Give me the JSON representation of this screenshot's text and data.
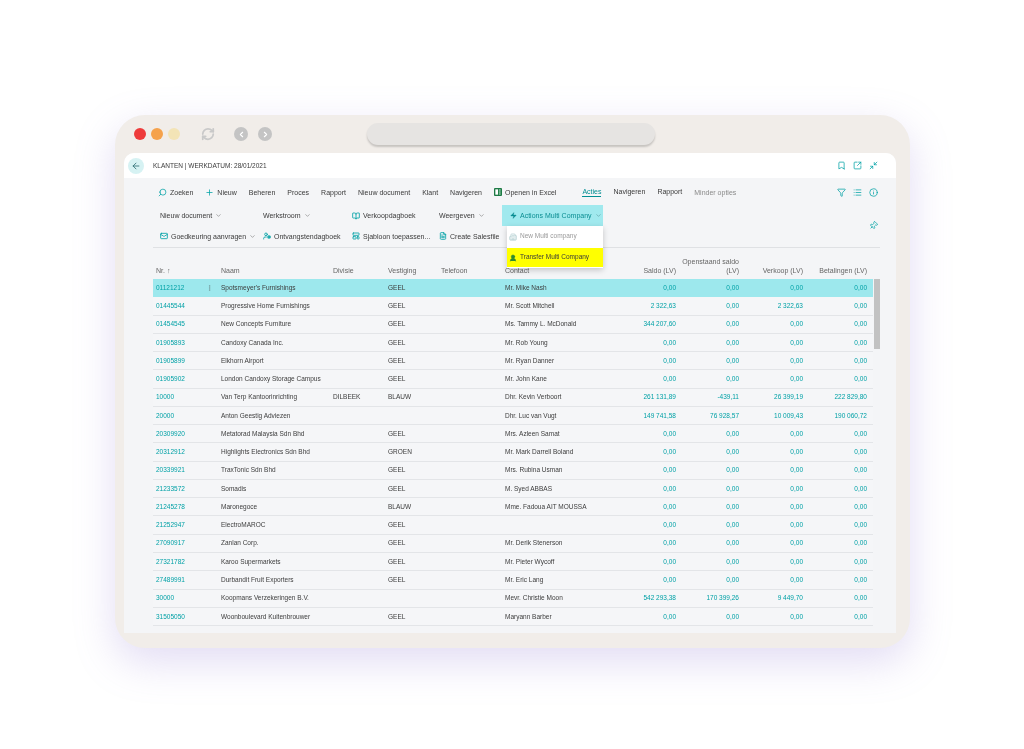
{
  "page": {
    "title": "KLANTEN | WERKDATUM: 28/01/2021"
  },
  "action_bar": {
    "actions": [
      {
        "label": "Zoeken",
        "kind": "search"
      },
      {
        "label": "Nieuw",
        "kind": "new"
      },
      {
        "label": "Beheren",
        "kind": "plain"
      },
      {
        "label": "Proces",
        "kind": "plain"
      },
      {
        "label": "Rapport",
        "kind": "plain"
      },
      {
        "label": "Nieuw document",
        "kind": "plain"
      },
      {
        "label": "Klant",
        "kind": "plain"
      },
      {
        "label": "Navigeren",
        "kind": "plain"
      },
      {
        "label": "Openen in Excel",
        "kind": "excel"
      }
    ],
    "tabs": [
      {
        "label": "Acties",
        "selected": true
      },
      {
        "label": "Navigeren",
        "selected": false
      },
      {
        "label": "Rapport",
        "selected": false
      }
    ],
    "less_options": "Minder opties"
  },
  "action_rows": [
    {
      "items": [
        {
          "label": "Nieuw document",
          "kind": "dropdown"
        },
        {
          "label": "Werkstroom",
          "kind": "dropdown"
        },
        {
          "label": "Verkoopdagboek",
          "kind": "journal"
        },
        {
          "label": "Weergeven",
          "kind": "dropdown"
        }
      ]
    },
    {
      "items": [
        {
          "label": "Goedkeuring aanvragen",
          "kind": "approval"
        },
        {
          "label": "Ontvangstendagboek",
          "kind": "receipts"
        },
        {
          "label": "Sjabloon toepassen...",
          "kind": "template"
        },
        {
          "label": "Create Salesfile",
          "kind": "file"
        }
      ]
    }
  ],
  "multi_company": {
    "label": "Actions Multi Company",
    "expanded": true,
    "menu": [
      {
        "label": "New Multi company",
        "disabled": true,
        "selected": false
      },
      {
        "label": "Transfer Multi Company",
        "disabled": false,
        "selected": true
      }
    ]
  },
  "table": {
    "columns": [
      {
        "label": "Nr. ↑",
        "kind": "link"
      },
      {
        "label": "Naam",
        "kind": "text"
      },
      {
        "label": "Divisie",
        "kind": "text"
      },
      {
        "label": "Vestiging",
        "kind": "text"
      },
      {
        "label": "Telefoon",
        "kind": "text"
      },
      {
        "label": "Contact",
        "kind": "text"
      },
      {
        "label": "Saldo (LV)",
        "kind": "amount"
      },
      {
        "label": "Openstaand saldo (LV)",
        "kind": "amount"
      },
      {
        "label": "Verkoop (LV)",
        "kind": "amount"
      },
      {
        "label": "Betalingen (LV)",
        "kind": "amount"
      }
    ],
    "rows": [
      {
        "selected": true,
        "nr": "01121212",
        "naam": "Spotsmeyer's Furnishings",
        "vestiging": "GEEL",
        "contact": "Mr. Mike Nash",
        "saldo": "0,00",
        "openstaand_saldo": "0,00",
        "verkoop": "0,00",
        "betalingen": "0,00"
      },
      {
        "selected": false,
        "nr": "01445544",
        "naam": "Progressive Home Furnishings",
        "vestiging": "GEEL",
        "contact": "Mr. Scott Mitchell",
        "saldo": "2 322,63",
        "openstaand_saldo": "0,00",
        "verkoop": "2 322,63",
        "betalingen": "0,00"
      },
      {
        "selected": false,
        "nr": "01454545",
        "naam": "New Concepts Furniture",
        "vestiging": "GEEL",
        "contact": "Ms. Tammy L. McDonald",
        "saldo": "344 207,60",
        "openstaand_saldo": "0,00",
        "verkoop": "0,00",
        "betalingen": "0,00"
      },
      {
        "selected": false,
        "nr": "01905893",
        "naam": "Candoxy Canada Inc.",
        "vestiging": "GEEL",
        "contact": "Mr. Rob Young",
        "saldo": "0,00",
        "openstaand_saldo": "0,00",
        "verkoop": "0,00",
        "betalingen": "0,00"
      },
      {
        "selected": false,
        "nr": "01905899",
        "naam": "Elkhorn Airport",
        "vestiging": "GEEL",
        "contact": "Mr. Ryan Danner",
        "saldo": "0,00",
        "openstaand_saldo": "0,00",
        "verkoop": "0,00",
        "betalingen": "0,00"
      },
      {
        "selected": false,
        "nr": "01905902",
        "naam": "London Candoxy Storage Campus",
        "vestiging": "GEEL",
        "contact": "Mr. John Kane",
        "saldo": "0,00",
        "openstaand_saldo": "0,00",
        "verkoop": "0,00",
        "betalingen": "0,00"
      },
      {
        "selected": false,
        "nr": "10000",
        "naam": "Van Terp Kantoorinrichting",
        "divisie": "DILBEEK",
        "vestiging": "BLAUW",
        "contact": "Dhr. Kevin Verboort",
        "saldo": "261 131,89",
        "openstaand_saldo": "-439,11",
        "verkoop": "26 399,19",
        "betalingen": "222 829,80"
      },
      {
        "selected": false,
        "nr": "20000",
        "naam": "Anton Geestig Adviezen",
        "contact": "Dhr. Luc van Vugt",
        "saldo": "149 741,58",
        "openstaand_saldo": "76 928,57",
        "verkoop": "10 009,43",
        "betalingen": "190 060,72"
      },
      {
        "selected": false,
        "nr": "20309920",
        "naam": "Metatorad Malaysia Sdn Bhd",
        "vestiging": "GEEL",
        "contact": "Mrs. Azleen Samat",
        "saldo": "0,00",
        "openstaand_saldo": "0,00",
        "verkoop": "0,00",
        "betalingen": "0,00"
      },
      {
        "selected": false,
        "nr": "20312912",
        "naam": "Highlights Electronics Sdn Bhd",
        "vestiging": "GROEN",
        "contact": "Mr. Mark Darrell Boland",
        "saldo": "0,00",
        "openstaand_saldo": "0,00",
        "verkoop": "0,00",
        "betalingen": "0,00"
      },
      {
        "selected": false,
        "nr": "20339921",
        "naam": "TraxTonic Sdn Bhd",
        "vestiging": "GEEL",
        "contact": "Mrs. Rubina Usman",
        "saldo": "0,00",
        "openstaand_saldo": "0,00",
        "verkoop": "0,00",
        "betalingen": "0,00"
      },
      {
        "selected": false,
        "nr": "21233572",
        "naam": "Somadis",
        "vestiging": "GEEL",
        "contact": "M. Syed ABBAS",
        "saldo": "0,00",
        "openstaand_saldo": "0,00",
        "verkoop": "0,00",
        "betalingen": "0,00"
      },
      {
        "selected": false,
        "nr": "21245278",
        "naam": "Maronegoce",
        "vestiging": "BLAUW",
        "contact": "Mme. Fadoua AIT MOUSSA",
        "saldo": "0,00",
        "openstaand_saldo": "0,00",
        "verkoop": "0,00",
        "betalingen": "0,00"
      },
      {
        "selected": false,
        "nr": "21252947",
        "naam": "ElectroMAROC",
        "vestiging": "GEEL",
        "saldo": "0,00",
        "openstaand_saldo": "0,00",
        "verkoop": "0,00",
        "betalingen": "0,00"
      },
      {
        "selected": false,
        "nr": "27090917",
        "naam": "Zanlan Corp.",
        "vestiging": "GEEL",
        "contact": "Mr. Derik Stenerson",
        "saldo": "0,00",
        "openstaand_saldo": "0,00",
        "verkoop": "0,00",
        "betalingen": "0,00"
      },
      {
        "selected": false,
        "nr": "27321782",
        "naam": "Karoo Supermarkets",
        "vestiging": "GEEL",
        "contact": "Mr. Pieter Wycoff",
        "saldo": "0,00",
        "openstaand_saldo": "0,00",
        "verkoop": "0,00",
        "betalingen": "0,00"
      },
      {
        "selected": false,
        "nr": "27489991",
        "naam": "Durbandit Fruit Exporters",
        "vestiging": "GEEL",
        "contact": "Mr. Eric Lang",
        "saldo": "0,00",
        "openstaand_saldo": "0,00",
        "verkoop": "0,00",
        "betalingen": "0,00"
      },
      {
        "selected": false,
        "nr": "30000",
        "naam": "Koopmans Verzekeringen B.V.",
        "contact": "Mevr. Christie Moon",
        "saldo": "542 293,38",
        "openstaand_saldo": "170 399,26",
        "verkoop": "9 449,70",
        "betalingen": "0,00"
      },
      {
        "selected": false,
        "nr": "31505050",
        "naam": "Woonboulevard Kuitenbrouwer",
        "vestiging": "GEEL",
        "contact": "Maryann Barber",
        "saldo": "0,00",
        "openstaand_saldo": "0,00",
        "verkoop": "0,00",
        "betalingen": "0,00"
      }
    ]
  }
}
